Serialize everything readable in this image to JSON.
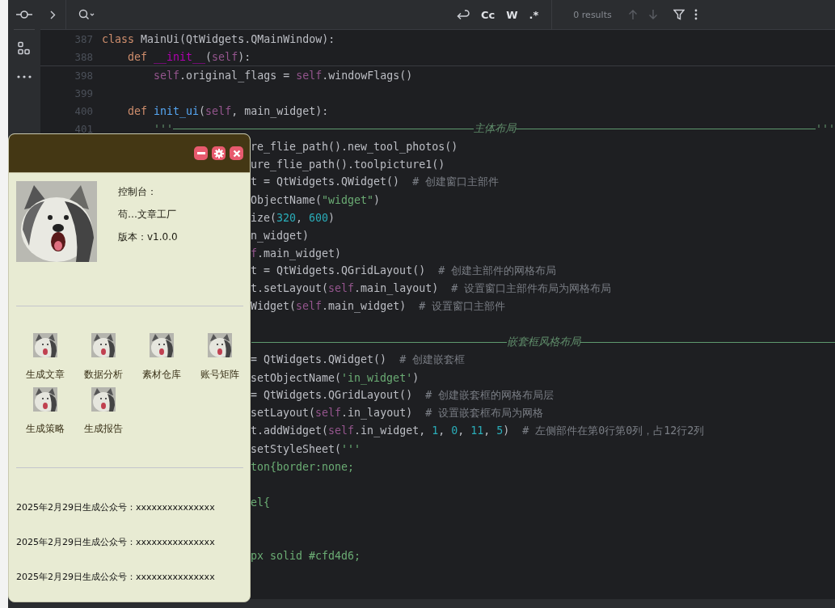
{
  "find_bar": {
    "options": [
      {
        "kind": "wrap"
      },
      {
        "kind": "text",
        "label": "Cc"
      },
      {
        "kind": "text",
        "label": "W"
      },
      {
        "kind": "text",
        "label": ".*"
      }
    ],
    "results": "0 results"
  },
  "editor": {
    "sticky": [
      {
        "n": "387",
        "code": [
          {
            "kind": "keyword",
            "text": "class "
          },
          {
            "kind": "plain",
            "text": "MainUi(QtWidgets.QMainWindow):"
          }
        ]
      },
      {
        "n": "388",
        "code": [
          {
            "kind": "keyword",
            "text": "    def "
          },
          {
            "kind": "magic",
            "text": "__init__"
          },
          {
            "kind": "plain",
            "text": "("
          },
          {
            "kind": "self",
            "text": "self"
          },
          {
            "kind": "plain",
            "text": "):"
          }
        ]
      }
    ],
    "lines": [
      {
        "n": "398",
        "code": [
          {
            "kind": "self",
            "text": "        self"
          },
          {
            "kind": "plain",
            "text": ".original_flags = "
          },
          {
            "kind": "self",
            "text": "self"
          },
          {
            "kind": "plain",
            "text": ".windowFlags()"
          }
        ]
      },
      {
        "n": "399"
      },
      {
        "n": "400",
        "code": [
          {
            "kind": "keyword",
            "text": "    def "
          },
          {
            "kind": "func",
            "text": "init_ui"
          },
          {
            "kind": "plain",
            "text": "("
          },
          {
            "kind": "self",
            "text": "self"
          },
          {
            "kind": "plain",
            "text": ", main_widget):"
          }
        ]
      },
      {
        "n": "401",
        "rule": {
          "prefix": "        '''",
          "label": "主体布局",
          "suffix": "'''"
        }
      },
      {
        "covered": true,
        "code": [
          {
            "kind": "plain",
            "text": "re_flie_path().new_tool_photos()"
          }
        ]
      },
      {
        "covered": true,
        "code": [
          {
            "kind": "plain",
            "text": "ure_flie_path().toolpicture1()"
          }
        ]
      },
      {
        "covered": true,
        "code": [
          {
            "kind": "plain",
            "text": "t = QtWidgets.QWidget()  "
          },
          {
            "kind": "comment",
            "text": "# 创建窗口主部件"
          }
        ]
      },
      {
        "covered": true,
        "code": [
          {
            "kind": "plain",
            "text": "ObjectName("
          },
          {
            "kind": "string",
            "text": "\"widget\""
          },
          {
            "kind": "plain",
            "text": ")"
          }
        ]
      },
      {
        "covered": true,
        "code": [
          {
            "kind": "plain",
            "text": "ize("
          },
          {
            "kind": "number",
            "text": "320"
          },
          {
            "kind": "plain",
            "text": ", "
          },
          {
            "kind": "number",
            "text": "600"
          },
          {
            "kind": "plain",
            "text": ")"
          }
        ]
      },
      {
        "covered": true,
        "code": [
          {
            "kind": "plain",
            "text": "n_widget)"
          }
        ]
      },
      {
        "covered": true,
        "code": [
          {
            "kind": "self",
            "text": "f"
          },
          {
            "kind": "plain",
            "text": ".main_widget)"
          }
        ]
      },
      {
        "covered": true,
        "code": [
          {
            "kind": "plain",
            "text": "t = QtWidgets.QGridLayout()  "
          },
          {
            "kind": "comment",
            "text": "# 创建主部件的网格布局"
          }
        ]
      },
      {
        "covered": true,
        "code": [
          {
            "kind": "plain",
            "text": "t.setLayout("
          },
          {
            "kind": "self",
            "text": "self"
          },
          {
            "kind": "plain",
            "text": ".main_layout)  "
          },
          {
            "kind": "comment",
            "text": "# 设置窗口主部件布局为网格布局"
          }
        ]
      },
      {
        "covered": true,
        "code": [
          {
            "kind": "plain",
            "text": "Widget("
          },
          {
            "kind": "self",
            "text": "self"
          },
          {
            "kind": "plain",
            "text": ".main_widget)  "
          },
          {
            "kind": "comment",
            "text": "# 设置窗口主部件"
          }
        ]
      },
      {
        "covered": true,
        "kind": "after-blank",
        "rule": {
          "label": "嵌套框风格布局"
        }
      },
      {
        "covered": true,
        "code": [
          {
            "kind": "plain",
            "text": "= QtWidgets.QWidget()  "
          },
          {
            "kind": "comment",
            "text": "# 创建嵌套框"
          }
        ]
      },
      {
        "covered": true,
        "code": [
          {
            "kind": "plain",
            "text": "setObjectName("
          },
          {
            "kind": "string",
            "text": "'in_widget'"
          },
          {
            "kind": "plain",
            "text": ")"
          }
        ]
      },
      {
        "covered": true,
        "code": [
          {
            "kind": "plain",
            "text": "= QtWidgets.QGridLayout()  "
          },
          {
            "kind": "comment",
            "text": "# 创建嵌套框的网格布局层"
          }
        ]
      },
      {
        "covered": true,
        "code": [
          {
            "kind": "plain",
            "text": "setLayout("
          },
          {
            "kind": "self",
            "text": "self"
          },
          {
            "kind": "plain",
            "text": ".in_layout)  "
          },
          {
            "kind": "comment",
            "text": "# 设置嵌套框布局为网格"
          }
        ]
      },
      {
        "covered": true,
        "code": [
          {
            "kind": "plain",
            "text": "t.addWidget("
          },
          {
            "kind": "self",
            "text": "self"
          },
          {
            "kind": "plain",
            "text": ".in_widget, "
          },
          {
            "kind": "number",
            "text": "1"
          },
          {
            "kind": "plain",
            "text": ", "
          },
          {
            "kind": "number",
            "text": "0"
          },
          {
            "kind": "plain",
            "text": ", "
          },
          {
            "kind": "number",
            "text": "11"
          },
          {
            "kind": "plain",
            "text": ", "
          },
          {
            "kind": "number",
            "text": "5"
          },
          {
            "kind": "plain",
            "text": ")  "
          },
          {
            "kind": "comment",
            "text": "# 左侧部件在第0行第0列，占12行2列"
          }
        ]
      },
      {
        "covered": true,
        "code": [
          {
            "kind": "plain",
            "text": "setStyleSheet("
          },
          {
            "kind": "string",
            "text": "'''"
          }
        ]
      },
      {
        "covered": true,
        "code": [
          {
            "kind": "string",
            "text": "ton{border:none;"
          }
        ]
      },
      {
        "covered": true,
        "kind": "after-blank",
        "code": [
          {
            "kind": "string",
            "text": "el{"
          }
        ]
      },
      {
        "covered": true,
        "kind": "after-two-blanks",
        "code": [
          {
            "kind": "string",
            "text": "px solid #cfd4d6;"
          }
        ]
      }
    ]
  },
  "app_window": {
    "labels": [
      "控制台：",
      "苟…文章工厂",
      "版本：v1.0.0"
    ],
    "tools": [
      {
        "label": "生成文章"
      },
      {
        "label": "数据分析"
      },
      {
        "label": "素材仓库"
      },
      {
        "label": "账号矩阵"
      },
      {
        "label": "生成策略"
      },
      {
        "label": "生成报告"
      }
    ],
    "entries": [
      "2025年2月29日生成公众号：xxxxxxxxxxxxxxx",
      "2025年2月29日生成公众号：xxxxxxxxxxxxxxx",
      "2025年2月29日生成公众号：xxxxxxxxxxxxxxx"
    ]
  }
}
